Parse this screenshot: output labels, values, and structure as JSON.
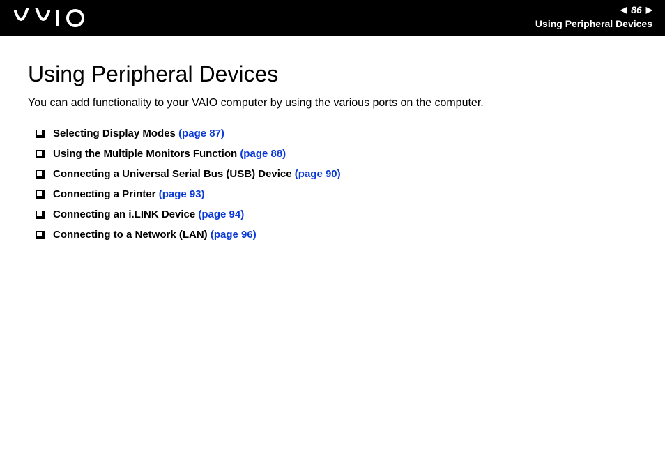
{
  "header": {
    "page_number": "86",
    "section_title": "Using Peripheral Devices"
  },
  "main": {
    "heading": "Using Peripheral Devices",
    "intro": "You can add functionality to your VAIO computer by using the various ports on the computer.",
    "items": [
      {
        "title": "Selecting Display Modes",
        "page_ref": "(page 87)"
      },
      {
        "title": "Using the Multiple Monitors Function",
        "page_ref": "(page 88)"
      },
      {
        "title": "Connecting a Universal Serial Bus (USB) Device",
        "page_ref": "(page 90)"
      },
      {
        "title": "Connecting a Printer",
        "page_ref": "(page 93)"
      },
      {
        "title": "Connecting an i.LINK Device",
        "page_ref": "(page 94)"
      },
      {
        "title": "Connecting to a Network (LAN)",
        "page_ref": "(page 96)"
      }
    ]
  }
}
